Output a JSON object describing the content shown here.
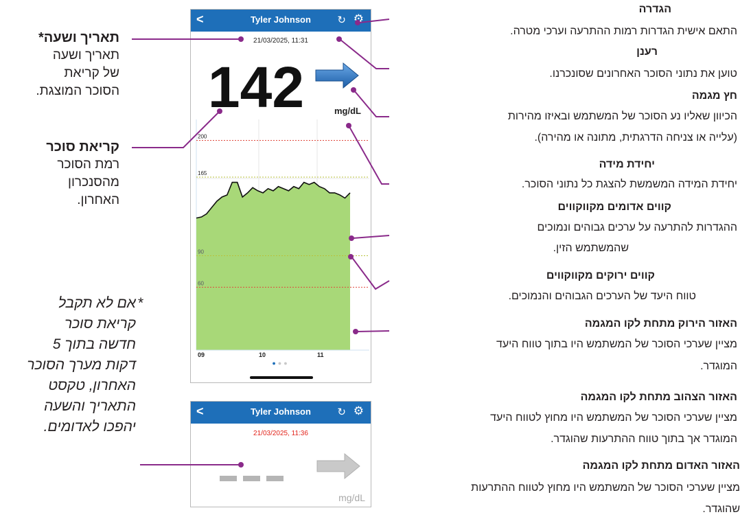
{
  "phone_main": {
    "user_name": "Tyler Johnson",
    "back_label": "<",
    "refresh_icon": "refresh-icon",
    "settings_icon": "gear-icon",
    "timestamp": "21/03/2025, 11:31",
    "reading": "142",
    "unit": "mg/dL",
    "trend": "arrow-right"
  },
  "chart_data": {
    "type": "area",
    "x_tick_labels": [
      "09",
      "10",
      "11"
    ],
    "y_tick_labels": [
      "200",
      "165",
      "90",
      "60"
    ],
    "threshold_lines": [
      {
        "value": 200,
        "color": "#e0483c",
        "label": "200"
      },
      {
        "value": 165,
        "color": "#b8c23a",
        "label": "165"
      },
      {
        "value": 90,
        "color": "#b8c23a",
        "label": "90"
      },
      {
        "value": 60,
        "color": "#e0483c",
        "label": "60"
      }
    ],
    "ylim": [
      0,
      220
    ],
    "fill_color": "#a8d878",
    "series": [
      {
        "values": [
          126,
          127,
          130,
          136,
          142,
          146,
          148,
          160,
          160,
          146,
          150,
          155,
          152,
          150,
          154,
          152,
          156,
          154,
          152,
          156,
          154,
          160,
          158,
          160,
          156,
          154,
          150,
          150,
          148,
          145,
          150
        ]
      }
    ],
    "page_dots": 3
  },
  "phone_second": {
    "user_name": "Tyler Johnson",
    "timestamp": "21/03/2025, 11:36",
    "timestamp_color": "#e2231a",
    "reading_placeholder": "- - -",
    "unit": "mg/dL"
  },
  "left_callouts": {
    "datetime_title": "תאריך ושעה*",
    "datetime_body": [
      "תאריך ושעה",
      "של קריאת",
      "הסוכר המוצגת."
    ],
    "reading_title": "קריאת סוכר",
    "reading_body": [
      "רמת הסוכר",
      "מהסנכרון",
      "האחרון."
    ],
    "note_star": "*",
    "note_lines": [
      "אם לא תקבל",
      "קריאת סוכר",
      "חדשה בתוך 5",
      "דקות מערך הסוכר",
      "האחרון, טקסט",
      "התאריך והשעה",
      "יהפכו לאדומים."
    ]
  },
  "right_callouts": {
    "settings_title": "הגדרה",
    "settings_body": "התאם אישית הגדרות רמות ההתרעה וערכי מטרה.",
    "refresh_title": "רענן",
    "refresh_body": "טוען את נתוני הסוכר האחרונים שסונכרנו.",
    "trend_title": "חץ מגמה",
    "trend_body": [
      "הכיוון שאליו נע הסוכר של המשתמש ובאיזו מהירות",
      "(עלייה או צניחה הדרגתית, מתונה או מהירה)."
    ],
    "unit_title": "יחידת מידה",
    "unit_body": "יחידת המידה המשמשת להצגת כל נתוני הסוכר.",
    "red_title": "קווים אדומים מקווקווים",
    "red_body": [
      "ההגדרות להתרעה על ערכים גבוהים ונמוכים",
      "שהמשתמש הזין."
    ],
    "green_title": "קווים ירוקים מקווקווים",
    "green_body": "טווח היעד של הערכים הגבוהים והנמוכים.",
    "green_area_title": "האזור הירוק מתחת לקו המגמה",
    "green_area_body": [
      "מציין שערכי הסוכר של המשתמש היו בתוך טווח היעד",
      "המוגדר."
    ],
    "yellow_area_title": "האזור הצהוב מתחת לקו המגמה",
    "yellow_area_body": [
      "מציין שערכי הסוכר של המשתמש היו מחוץ לטווח היעד",
      "המוגדר אך בתוך טווח ההתרעות שהוגדר."
    ],
    "red_area_title": "האזור האדום מתחת לקו המגמה",
    "red_area_body": [
      "מציין שערכי הסוכר של המשתמש היו מחוץ לטווח ההתרעות",
      "שהוגדר."
    ]
  }
}
